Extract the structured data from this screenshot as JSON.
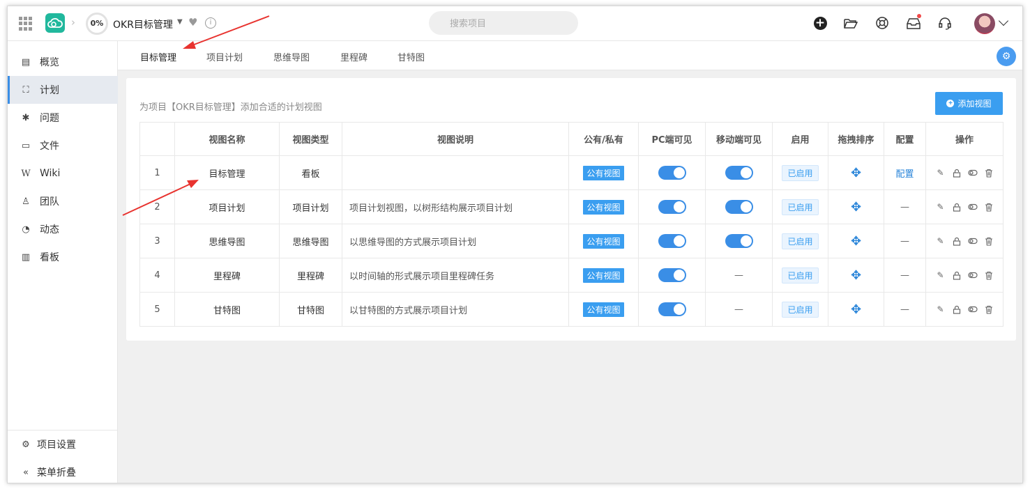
{
  "header": {
    "progress": "0%",
    "project_name": "OKR目标管理",
    "search_placeholder": "搜索项目"
  },
  "sidebar": {
    "items": [
      {
        "label": "概览",
        "icon": "overview-icon"
      },
      {
        "label": "计划",
        "icon": "plan-icon",
        "active": true
      },
      {
        "label": "问题",
        "icon": "bug-icon"
      },
      {
        "label": "文件",
        "icon": "folder-icon"
      },
      {
        "label": "Wiki",
        "icon": "wiki-icon"
      },
      {
        "label": "团队",
        "icon": "team-icon"
      },
      {
        "label": "动态",
        "icon": "activity-icon"
      },
      {
        "label": "看板",
        "icon": "chart-icon"
      }
    ],
    "settings_label": "项目设置",
    "collapse_label": "菜单折叠"
  },
  "tabs": [
    "目标管理",
    "项目计划",
    "思维导图",
    "里程碑",
    "甘特图"
  ],
  "card": {
    "hint": "为项目【OKR目标管理】添加合适的计划视图",
    "add_button": "添加视图"
  },
  "table": {
    "columns": [
      "",
      "视图名称",
      "视图类型",
      "视图说明",
      "公有/私有",
      "PC端可见",
      "移动端可见",
      "启用",
      "拖拽排序",
      "配置",
      "操作"
    ],
    "rows": [
      {
        "index": "1",
        "name": "目标管理",
        "type": "看板",
        "desc": "",
        "visibility": "公有视图",
        "pc": true,
        "mobile": true,
        "enabled": "已启用",
        "config": "配置"
      },
      {
        "index": "2",
        "name": "项目计划",
        "type": "项目计划",
        "desc": "项目计划视图，以树形结构展示项目计划",
        "visibility": "公有视图",
        "pc": true,
        "mobile": true,
        "enabled": "已启用",
        "config": "—"
      },
      {
        "index": "3",
        "name": "思维导图",
        "type": "思维导图",
        "desc": "以思维导图的方式展示项目计划",
        "visibility": "公有视图",
        "pc": true,
        "mobile": true,
        "enabled": "已启用",
        "config": "—"
      },
      {
        "index": "4",
        "name": "里程碑",
        "type": "里程碑",
        "desc": "以时间轴的形式展示项目里程碑任务",
        "visibility": "公有视图",
        "pc": true,
        "mobile": false,
        "enabled": "已启用",
        "config": "—"
      },
      {
        "index": "5",
        "name": "甘特图",
        "type": "甘特图",
        "desc": "以甘特图的方式展示项目计划",
        "visibility": "公有视图",
        "pc": true,
        "mobile": false,
        "enabled": "已启用",
        "config": "—"
      }
    ],
    "dash": "—"
  },
  "colors": {
    "accent": "#3a9ef0",
    "toggle_on": "#3a8ee6",
    "annotation_arrow": "#e8332f"
  }
}
